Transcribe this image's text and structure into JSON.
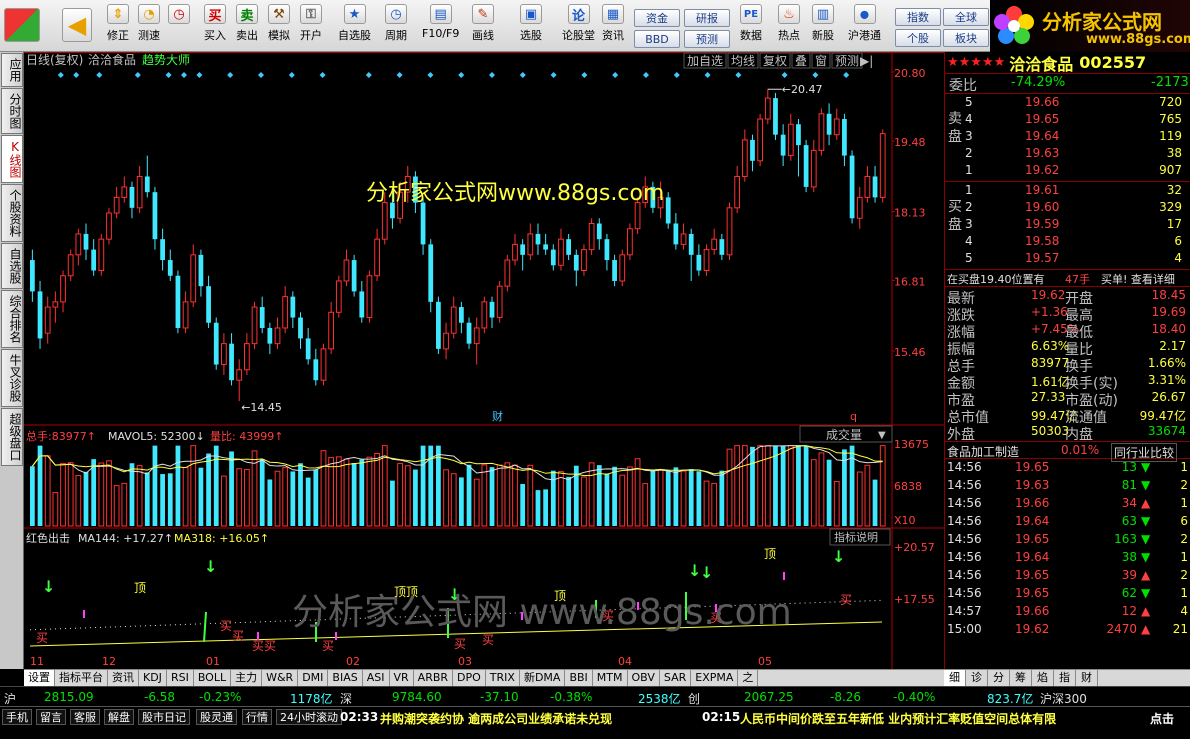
{
  "toolbar": {
    "buttons": [
      {
        "label": "修正",
        "icon": "up-down-arrow-icon"
      },
      {
        "label": "测速",
        "icon": "speed-dial-icon"
      },
      {
        "label": "买入",
        "icon": "buy-icon",
        "glyph": "买"
      },
      {
        "label": "卖出",
        "icon": "sell-icon",
        "glyph": "卖"
      },
      {
        "label": "模拟",
        "icon": "hammer-icon"
      },
      {
        "label": "开户",
        "icon": "lock-icon"
      },
      {
        "label": "自选股",
        "icon": "star-icon"
      },
      {
        "label": "周期",
        "icon": "clock-icon"
      },
      {
        "label": "F10/F9",
        "icon": "f10-icon"
      },
      {
        "label": "画线",
        "icon": "pencil-icon"
      },
      {
        "label": "选股",
        "icon": "screen-icon"
      },
      {
        "label": "论股堂",
        "icon": "lun-icon",
        "glyph": "论"
      },
      {
        "label": "资讯",
        "icon": "news-icon"
      },
      {
        "label": "数据",
        "icon": "pe-icon",
        "glyph": "PE"
      },
      {
        "label": "热点",
        "icon": "fire-icon"
      },
      {
        "label": "新股",
        "icon": "new-stock-icon"
      },
      {
        "label": "沪港通",
        "icon": "sse-hk-icon"
      }
    ],
    "small_buttons": [
      "资金",
      "BBD",
      "研报",
      "预测",
      "指数",
      "个股",
      "全球",
      "板块"
    ]
  },
  "logo": {
    "title": "分析家公式网",
    "url": "www.88gs.com"
  },
  "left_tabs": [
    "应用",
    "分时图",
    "K线图",
    "个股资料",
    "自选股",
    "综合排名",
    "牛叉诊股",
    "超级盘口"
  ],
  "chart": {
    "header": {
      "period": "日线(复权)",
      "stock": "洽洽食品",
      "indicator": "趋势大师"
    },
    "top_buttons": [
      "加自选",
      "均线",
      "复权",
      "叠",
      "窗",
      "预测"
    ],
    "watermark": "分析家公式网www.88gs.com",
    "watermark2": "分析家公式网 www.88gs.com",
    "price_axis": [
      "20.80",
      "19.48",
      "18.13",
      "16.81",
      "15.46"
    ],
    "volume_axis": [
      "13675",
      "6838",
      "X10"
    ],
    "ind_axis": [
      "+20.57",
      "+17.55"
    ],
    "high_label": "20.47",
    "low_label": "14.45",
    "cai": "财",
    "q": "q",
    "volume_header": {
      "total_label": "总手:",
      "total": "83977",
      "mavol_label": "MAVOL5:",
      "mavol": "52300",
      "ratio_label": "量比:",
      "ratio": "43999"
    },
    "volume_select": "成交量",
    "indicator_header": {
      "name": "红色出击",
      "ma144_label": "MA144:",
      "ma144": "+17.27",
      "ma318_label": "MA318:",
      "ma318": "+16.05"
    },
    "indicator_btn": "指标说明",
    "x_labels": [
      "11",
      "12",
      "01",
      "02",
      "03",
      "04",
      "05"
    ],
    "signals": [
      "顶",
      "顶顶",
      "顶",
      "顶",
      "买",
      "买",
      "买",
      "买买",
      "买",
      "买",
      "买",
      "买",
      "买"
    ],
    "candles": [
      [
        17.2,
        16.6,
        17.4,
        16.4
      ],
      [
        16.6,
        15.7,
        16.8,
        15.5
      ],
      [
        15.8,
        16.3,
        16.5,
        15.6
      ],
      [
        16.3,
        16.4,
        16.6,
        16.0
      ],
      [
        16.4,
        16.9,
        17.0,
        16.2
      ],
      [
        16.9,
        17.3,
        17.4,
        16.8
      ],
      [
        17.3,
        17.7,
        17.8,
        17.1
      ],
      [
        17.7,
        17.4,
        17.9,
        17.2
      ],
      [
        17.4,
        17.0,
        17.6,
        16.9
      ],
      [
        17.0,
        17.6,
        17.7,
        16.9
      ],
      [
        17.6,
        18.1,
        18.2,
        17.5
      ],
      [
        18.1,
        18.4,
        18.6,
        18.0
      ],
      [
        18.4,
        18.6,
        18.8,
        18.3
      ],
      [
        18.6,
        18.2,
        18.7,
        18.0
      ],
      [
        18.2,
        18.8,
        19.0,
        18.1
      ],
      [
        18.8,
        18.5,
        19.2,
        18.4
      ],
      [
        18.5,
        17.6,
        18.6,
        17.4
      ],
      [
        17.6,
        17.2,
        17.8,
        17.0
      ],
      [
        17.2,
        16.9,
        17.4,
        16.8
      ],
      [
        16.9,
        15.9,
        17.0,
        15.8
      ],
      [
        15.9,
        16.4,
        16.6,
        15.8
      ],
      [
        16.4,
        17.3,
        17.5,
        16.3
      ],
      [
        17.3,
        16.7,
        17.4,
        16.5
      ],
      [
        16.7,
        16.0,
        16.9,
        15.9
      ],
      [
        16.0,
        15.2,
        16.1,
        15.1
      ],
      [
        15.2,
        15.6,
        15.8,
        15.0
      ],
      [
        15.6,
        14.9,
        15.8,
        14.8
      ],
      [
        14.9,
        15.1,
        15.3,
        14.5
      ],
      [
        15.1,
        15.6,
        15.8,
        15.0
      ],
      [
        15.6,
        16.3,
        16.4,
        15.5
      ],
      [
        16.3,
        15.9,
        16.5,
        15.8
      ],
      [
        15.9,
        15.6,
        16.0,
        15.4
      ],
      [
        15.6,
        15.9,
        16.1,
        15.5
      ],
      [
        15.9,
        16.5,
        16.7,
        15.8
      ],
      [
        16.5,
        16.1,
        16.6,
        15.9
      ],
      [
        16.1,
        15.7,
        16.2,
        15.5
      ],
      [
        15.7,
        15.3,
        15.9,
        15.2
      ],
      [
        15.3,
        14.9,
        15.5,
        14.8
      ],
      [
        14.9,
        15.5,
        15.6,
        14.8
      ],
      [
        15.5,
        16.2,
        16.4,
        15.4
      ],
      [
        16.2,
        16.8,
        16.9,
        16.1
      ],
      [
        16.8,
        17.2,
        17.4,
        16.7
      ],
      [
        17.2,
        16.6,
        17.3,
        16.5
      ],
      [
        16.6,
        16.1,
        16.8,
        16.0
      ],
      [
        16.1,
        16.9,
        17.0,
        16.0
      ],
      [
        16.9,
        17.6,
        17.8,
        16.8
      ],
      [
        17.6,
        18.3,
        18.5,
        17.5
      ],
      [
        18.3,
        18.0,
        18.6,
        17.8
      ],
      [
        18.0,
        18.5,
        18.7,
        17.9
      ],
      [
        18.5,
        18.8,
        19.0,
        18.3
      ],
      [
        18.8,
        18.3,
        18.9,
        18.1
      ],
      [
        18.3,
        17.5,
        18.4,
        17.3
      ],
      [
        17.5,
        16.4,
        17.6,
        16.2
      ],
      [
        16.4,
        15.5,
        16.5,
        15.4
      ],
      [
        15.5,
        15.8,
        16.0,
        15.3
      ],
      [
        15.8,
        16.3,
        16.5,
        15.7
      ],
      [
        16.3,
        16.0,
        16.4,
        15.8
      ],
      [
        16.0,
        15.6,
        16.1,
        15.5
      ],
      [
        15.6,
        15.9,
        16.1,
        15.2
      ],
      [
        15.9,
        16.4,
        16.5,
        15.8
      ],
      [
        16.4,
        16.1,
        16.5,
        15.9
      ],
      [
        16.1,
        16.7,
        16.8,
        16.0
      ],
      [
        16.7,
        17.2,
        17.3,
        16.6
      ],
      [
        17.2,
        17.5,
        17.7,
        17.1
      ],
      [
        17.5,
        17.3,
        17.6,
        17.0
      ],
      [
        17.3,
        17.7,
        17.9,
        17.2
      ],
      [
        17.7,
        17.5,
        17.9,
        17.3
      ],
      [
        17.5,
        17.4,
        17.7,
        17.3
      ],
      [
        17.4,
        17.1,
        17.5,
        17.0
      ],
      [
        17.1,
        17.6,
        17.8,
        17.0
      ],
      [
        17.6,
        17.3,
        17.7,
        17.2
      ],
      [
        17.3,
        17.0,
        17.4,
        16.7
      ],
      [
        17.0,
        17.4,
        17.5,
        16.9
      ],
      [
        17.4,
        17.9,
        18.0,
        17.3
      ],
      [
        17.9,
        17.6,
        18.0,
        17.4
      ],
      [
        17.6,
        17.2,
        17.7,
        17.0
      ],
      [
        17.2,
        16.8,
        17.3,
        16.7
      ],
      [
        16.8,
        17.3,
        17.4,
        16.7
      ],
      [
        17.3,
        17.8,
        17.9,
        17.2
      ],
      [
        17.8,
        18.3,
        18.4,
        17.7
      ],
      [
        18.3,
        18.6,
        18.8,
        18.2
      ],
      [
        18.6,
        18.2,
        18.7,
        18.1
      ],
      [
        18.2,
        18.4,
        18.7,
        18.0
      ],
      [
        18.4,
        17.9,
        18.5,
        17.8
      ],
      [
        17.9,
        17.5,
        18.1,
        17.4
      ],
      [
        17.5,
        17.7,
        17.9,
        17.4
      ],
      [
        17.7,
        17.3,
        17.8,
        16.8
      ],
      [
        17.3,
        17.0,
        17.5,
        16.9
      ],
      [
        17.0,
        17.4,
        17.5,
        16.9
      ],
      [
        17.4,
        17.6,
        17.8,
        17.3
      ],
      [
        17.6,
        17.3,
        17.7,
        17.2
      ],
      [
        17.3,
        18.2,
        18.3,
        17.2
      ],
      [
        18.2,
        18.8,
        19.0,
        18.1
      ],
      [
        18.8,
        19.5,
        19.7,
        18.7
      ],
      [
        19.5,
        19.1,
        19.6,
        18.9
      ],
      [
        19.1,
        19.9,
        20.0,
        19.0
      ],
      [
        19.9,
        20.3,
        20.47,
        19.8
      ],
      [
        20.3,
        19.6,
        20.4,
        19.5
      ],
      [
        19.6,
        19.2,
        19.8,
        19.0
      ],
      [
        19.2,
        19.8,
        20.0,
        19.1
      ],
      [
        19.8,
        19.4,
        19.9,
        18.8
      ],
      [
        19.4,
        18.6,
        19.5,
        18.5
      ],
      [
        18.6,
        19.3,
        19.5,
        18.5
      ],
      [
        19.3,
        20.0,
        20.1,
        19.2
      ],
      [
        20.0,
        19.6,
        20.2,
        19.4
      ],
      [
        19.6,
        19.9,
        20.1,
        19.5
      ],
      [
        19.9,
        19.2,
        20.0,
        19.0
      ],
      [
        19.2,
        18.0,
        19.3,
        17.9
      ],
      [
        18.0,
        18.4,
        18.6,
        17.8
      ],
      [
        18.4,
        18.8,
        19.0,
        18.3
      ],
      [
        18.8,
        18.4,
        19.0,
        18.3
      ],
      [
        18.4,
        19.62,
        19.7,
        18.3
      ]
    ]
  },
  "right": {
    "title": "洽洽食品",
    "code": "002557",
    "stars": "★★★★★",
    "webi_label": "委比",
    "webi": "-74.29%",
    "webi_diff": "-2173",
    "sell_side": "卖盘",
    "buy_side": "买盘",
    "sell": [
      {
        "n": "5",
        "p": "19.66",
        "v": "720"
      },
      {
        "n": "4",
        "p": "19.65",
        "v": "765"
      },
      {
        "n": "3",
        "p": "19.64",
        "v": "119"
      },
      {
        "n": "2",
        "p": "19.63",
        "v": "38"
      },
      {
        "n": "1",
        "p": "19.62",
        "v": "907"
      }
    ],
    "buy": [
      {
        "n": "1",
        "p": "19.61",
        "v": "32"
      },
      {
        "n": "2",
        "p": "19.60",
        "v": "329"
      },
      {
        "n": "3",
        "p": "19.59",
        "v": "17"
      },
      {
        "n": "4",
        "p": "19.58",
        "v": "6"
      },
      {
        "n": "5",
        "p": "19.57",
        "v": "4"
      }
    ],
    "buy_note": {
      "a": "在买盘19.40位置有",
      "b": "47手",
      "c": "买单! 查看详细"
    },
    "stats": [
      {
        "l1": "最新",
        "v1": "19.62",
        "l2": "开盘",
        "v2": "18.45"
      },
      {
        "l1": "涨跌",
        "v1": "+1.36",
        "l2": "最高",
        "v2": "19.69"
      },
      {
        "l1": "涨幅",
        "v1": "+7.45%",
        "l2": "最低",
        "v2": "18.40"
      },
      {
        "l1": "振幅",
        "v1": "6.63%",
        "l2": "量比",
        "v2": "2.17"
      },
      {
        "l1": "总手",
        "v1": "83977",
        "l2": "换手",
        "v2": "1.66%"
      },
      {
        "l1": "金额",
        "v1": "1.61亿",
        "l2": "换手(实)",
        "v2": "3.31%"
      },
      {
        "l1": "市盈",
        "v1": "27.33",
        "l2": "市盈(动)",
        "v2": "26.67"
      },
      {
        "l1": "总市值",
        "v1": "99.47亿",
        "l2": "流通值",
        "v2": "99.47亿"
      },
      {
        "l1": "外盘",
        "v1": "50303",
        "l2": "内盘",
        "v2": "33674"
      }
    ],
    "industry": "食品加工制造",
    "industry_pct": "0.01%",
    "industry_btn": "同行业比较",
    "ticks": [
      {
        "t": "14:56",
        "p": "19.65",
        "v": "13",
        "d": "down"
      },
      {
        "t": "14:56",
        "p": "19.63",
        "v": "81",
        "d": "down"
      },
      {
        "t": "14:56",
        "p": "19.66",
        "v": "34",
        "d": "up"
      },
      {
        "t": "14:56",
        "p": "19.64",
        "v": "63",
        "d": "down"
      },
      {
        "t": "14:56",
        "p": "19.65",
        "v": "163",
        "d": "down"
      },
      {
        "t": "14:56",
        "p": "19.64",
        "v": "38",
        "d": "down"
      },
      {
        "t": "14:56",
        "p": "19.65",
        "v": "39",
        "d": "up"
      },
      {
        "t": "14:56",
        "p": "19.65",
        "v": "62",
        "d": "down"
      },
      {
        "t": "14:57",
        "p": "19.66",
        "v": "12",
        "d": "up"
      },
      {
        "t": "15:00",
        "p": "19.62",
        "v": "2470",
        "d": "up"
      }
    ],
    "tick_tail": [
      "1",
      "2",
      "1",
      "6",
      "2",
      "1",
      "2",
      "1",
      "4",
      "21"
    ],
    "tabs": [
      "细",
      "诊",
      "分",
      "筹",
      "焰",
      "指",
      "财"
    ]
  },
  "bottom_tabs": [
    "设置",
    "指标平台",
    "资讯",
    "KDJ",
    "RSI",
    "BOLL",
    "主力",
    "W&R",
    "DMI",
    "BIAS",
    "ASI",
    "VR",
    "ARBR",
    "DPO",
    "TRIX",
    "新DMA",
    "BBI",
    "MTM",
    "OBV",
    "SAR",
    "EXPMA",
    "之"
  ],
  "index_bar": {
    "sh_label": "沪",
    "sh": "2815.09",
    "sh_chg": "-6.58",
    "sh_pct": "-0.23%",
    "sh_amt": "1178亿",
    "sz_label": "深",
    "sz": "9784.60",
    "sz_chg": "-37.10",
    "sz_pct": "-0.38%",
    "sz_amt": "2538亿",
    "cy_label": "创",
    "cy": "2067.25",
    "cy_chg": "-8.26",
    "cy_pct": "-0.40%",
    "cy_amt": "823.7亿",
    "hs_label": "沪深300"
  },
  "status": {
    "buttons": [
      "手机",
      "留言",
      "客服",
      "解盘",
      "股市日记",
      "股灵通",
      "行情",
      "24小时滚动"
    ],
    "news1_time": "02:33",
    "news1": "并购潮突袭约协 逾两成公司业绩承诺未兑现",
    "news2_time": "02:15",
    "news2": "人民币中间价跌至五年新低 业内预计汇率贬值空间总体有限",
    "tail": "点击"
  },
  "colors": {
    "up": "#ff3030",
    "down": "#40e8ff",
    "bg": "#000000",
    "text_yellow": "#ffff40"
  }
}
